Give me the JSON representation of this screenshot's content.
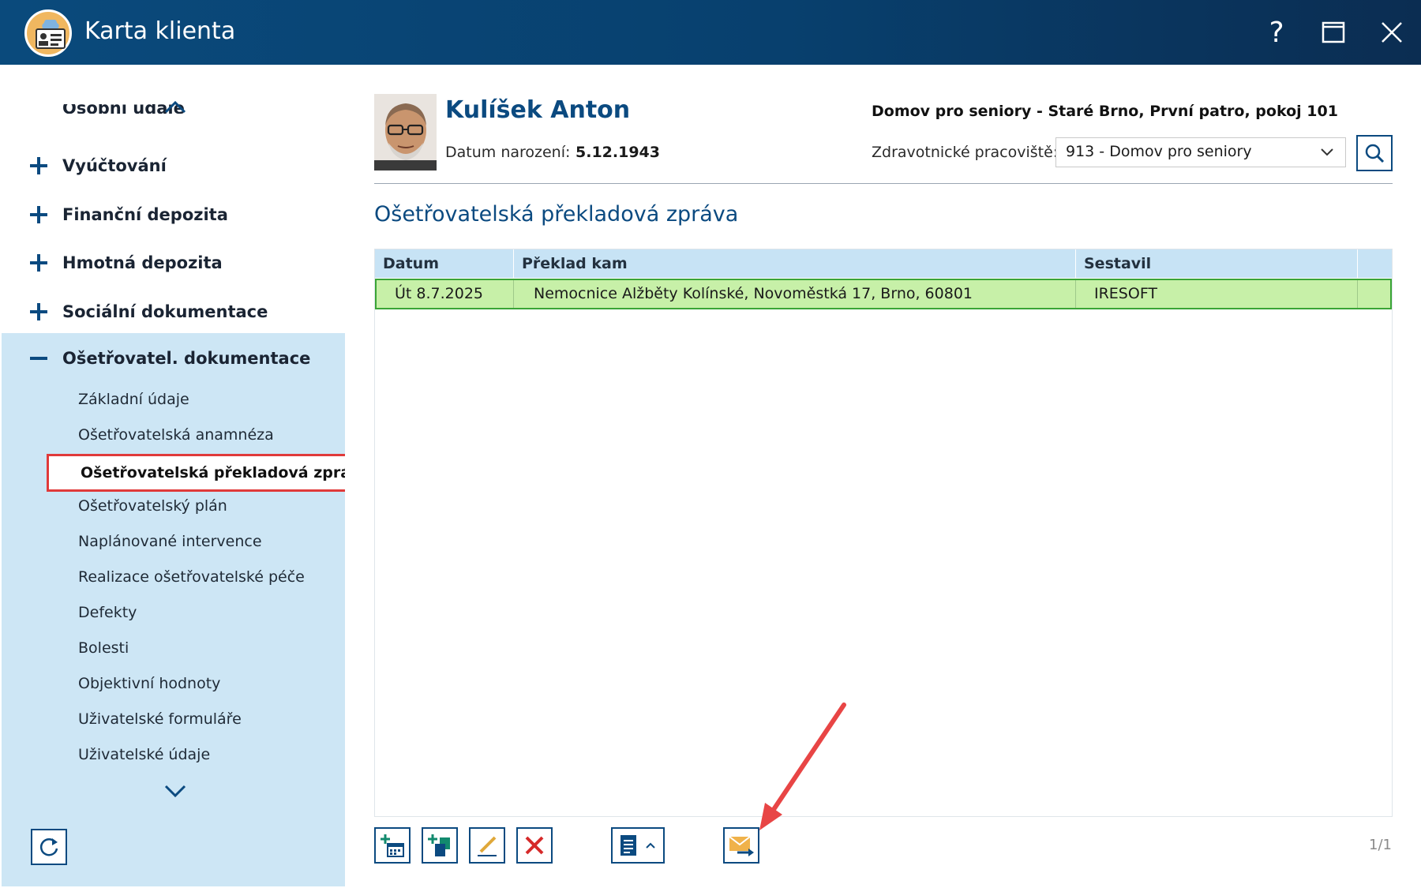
{
  "window": {
    "title": "Karta klienta",
    "help_glyph": "?",
    "close_glyph": "✕"
  },
  "sidebar": {
    "cut_item": "Osobní údaje",
    "groups": [
      {
        "label": "Vyúčtování",
        "sign": "+"
      },
      {
        "label": "Finanční depozita",
        "sign": "+"
      },
      {
        "label": "Hmotná depozita",
        "sign": "+"
      },
      {
        "label": "Sociální dokumentace",
        "sign": "+"
      },
      {
        "label": "Ošetřovatel. dokumentace",
        "sign": "−"
      }
    ],
    "subitems": [
      "Základní údaje",
      "Ošetřovatelská anamnéza",
      "Ošetřovatelská překladová zpráva",
      "Ošetřovatelský plán",
      "Naplánované intervence",
      "Realizace ošetřovatelské péče",
      "Defekty",
      "Bolesti",
      "Objektivní hodnoty",
      "Uživatelské formuláře",
      "Uživatelské údaje"
    ],
    "selected_index": 2
  },
  "client": {
    "name": "Kulíšek Anton",
    "dob_label": "Datum narození:",
    "dob_value": "5.12.1943",
    "location": "Domov pro seniory - Staré Brno, První patro, pokoj 101",
    "workplace_label": "Zdravotnické pracoviště:",
    "workplace_value": "913 - Domov pro seniory"
  },
  "section": {
    "title": "Ošetřovatelská překladová zpráva"
  },
  "table": {
    "columns": [
      "Datum",
      "Překlad kam",
      "Sestavil"
    ],
    "rows": [
      {
        "datum": "Út 8.7.2025",
        "preklad": "Nemocnice Alžběty Kolínské, Novoměstká 17, Brno, 60801",
        "sestavil": "IRESOFT"
      }
    ]
  },
  "toolbar": {
    "pager": "1/1"
  },
  "colors": {
    "brand": "#0b4a80",
    "sidebar_active": "#cde6f5",
    "row_selected": "#c7f0a8",
    "highlight_border": "#e03a3a"
  }
}
